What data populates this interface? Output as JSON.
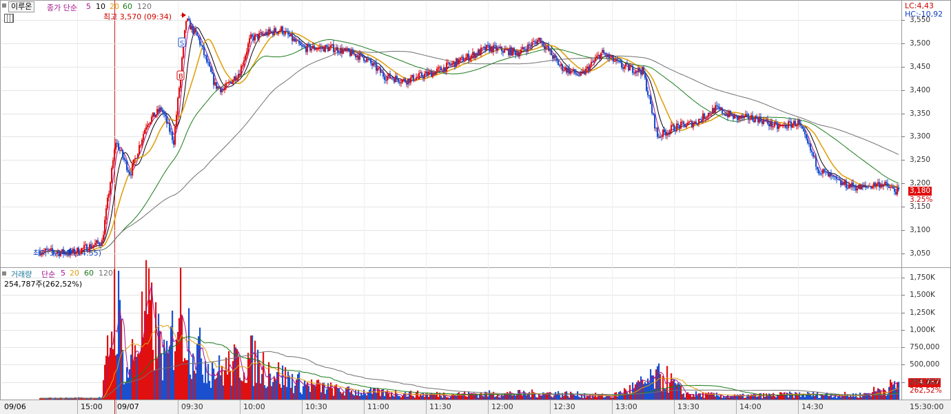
{
  "price_panel": {
    "stock_name": "이루온",
    "ma_label": "종가 단순",
    "periods": [
      "5",
      "10",
      "20",
      "60",
      "120"
    ],
    "period_colors": [
      "#a2148c",
      "#000000",
      "#e0a010",
      "#1a7a1a",
      "#707070"
    ],
    "high_label": "최고 3,570 (09:34)",
    "low_label": "최저 3,045 (14:55)",
    "lc": "LC:4,43",
    "hc": "HC:-10,92",
    "current_price": "3,180",
    "current_change": "3.25%",
    "signal_s": "S",
    "signal_b": "B"
  },
  "volume_panel": {
    "title": "거래량",
    "ma_label": "단순",
    "periods": [
      "5",
      "20",
      "60",
      "120"
    ],
    "value_text": "254,787주(262,52%)",
    "current_volume": "254,787",
    "current_ratio": "262,52%"
  },
  "chart_data": [
    {
      "type": "candlestick",
      "ylim": [
        3020,
        3590
      ],
      "yticks": [
        "3,050",
        "3,100",
        "3,150",
        "3,200",
        "3,250",
        "3,300",
        "3,350",
        "3,400",
        "3,450",
        "3,500",
        "3,550"
      ],
      "session_days": [
        "09/06",
        "09/07"
      ],
      "xticks": [
        "09/06",
        "15:00",
        "09/07",
        "09:30",
        "10:00",
        "10:30",
        "11:00",
        "11:30",
        "12:00",
        "12:30",
        "13:00",
        "13:30",
        "14:00",
        "14:30",
        "15:00",
        "15:30:00"
      ],
      "anchors": [
        {
          "t": "09/06 14:30",
          "v": 3055
        },
        {
          "t": "09/06 14:55",
          "v": 3050
        },
        {
          "t": "09/06 15:20",
          "v": 3075
        },
        {
          "t": "09:00",
          "v": 3290
        },
        {
          "t": "09:07",
          "v": 3220
        },
        {
          "t": "09:15",
          "v": 3330
        },
        {
          "t": "09:22",
          "v": 3360
        },
        {
          "t": "09:28",
          "v": 3290
        },
        {
          "t": "09:34",
          "v": 3550
        },
        {
          "t": "09:40",
          "v": 3510
        },
        {
          "t": "09:48",
          "v": 3410
        },
        {
          "t": "09:52",
          "v": 3400
        },
        {
          "t": "10:00",
          "v": 3440
        },
        {
          "t": "10:05",
          "v": 3510
        },
        {
          "t": "10:12",
          "v": 3520
        },
        {
          "t": "10:20",
          "v": 3530
        },
        {
          "t": "10:30",
          "v": 3490
        },
        {
          "t": "10:45",
          "v": 3490
        },
        {
          "t": "11:00",
          "v": 3470
        },
        {
          "t": "11:10",
          "v": 3430
        },
        {
          "t": "11:20",
          "v": 3420
        },
        {
          "t": "11:35",
          "v": 3440
        },
        {
          "t": "11:50",
          "v": 3470
        },
        {
          "t": "12:00",
          "v": 3490
        },
        {
          "t": "12:15",
          "v": 3480
        },
        {
          "t": "12:25",
          "v": 3510
        },
        {
          "t": "12:35",
          "v": 3450
        },
        {
          "t": "12:45",
          "v": 3430
        },
        {
          "t": "12:55",
          "v": 3480
        },
        {
          "t": "13:05",
          "v": 3450
        },
        {
          "t": "13:15",
          "v": 3440
        },
        {
          "t": "13:22",
          "v": 3300
        },
        {
          "t": "13:30",
          "v": 3320
        },
        {
          "t": "13:40",
          "v": 3330
        },
        {
          "t": "13:50",
          "v": 3360
        },
        {
          "t": "14:00",
          "v": 3340
        },
        {
          "t": "14:10",
          "v": 3340
        },
        {
          "t": "14:20",
          "v": 3320
        },
        {
          "t": "14:30",
          "v": 3330
        },
        {
          "t": "14:40",
          "v": 3230
        },
        {
          "t": "14:50",
          "v": 3200
        },
        {
          "t": "15:00",
          "v": 3190
        },
        {
          "t": "15:10",
          "v": 3200
        },
        {
          "t": "15:19",
          "v": 3180
        }
      ],
      "moving_averages": [
        {
          "period": 5,
          "color": "#a2148c"
        },
        {
          "period": 10,
          "color": "#000000"
        },
        {
          "period": 20,
          "color": "#e0a010"
        },
        {
          "period": 60,
          "color": "#1a7a1a"
        },
        {
          "period": 120,
          "color": "#707070"
        }
      ]
    },
    {
      "type": "bar",
      "ylim": [
        0,
        1900000
      ],
      "yticks": [
        "250,000",
        "500,000",
        "750,000",
        "1,000K",
        "1,250K",
        "1,500K",
        "1,750K"
      ],
      "volume_anchors": [
        {
          "t": "09/06 14:30",
          "v": 20000
        },
        {
          "t": "09/06 15:20",
          "v": 30000
        },
        {
          "t": "09:00",
          "v": 1900000
        },
        {
          "t": "09:05",
          "v": 420000
        },
        {
          "t": "09:15",
          "v": 1550000
        },
        {
          "t": "09:25",
          "v": 600000
        },
        {
          "t": "09:30",
          "v": 1720000
        },
        {
          "t": "09:40",
          "v": 800000
        },
        {
          "t": "09:50",
          "v": 500000
        },
        {
          "t": "10:05",
          "v": 720000
        },
        {
          "t": "10:20",
          "v": 420000
        },
        {
          "t": "10:30",
          "v": 280000
        },
        {
          "t": "10:50",
          "v": 150000
        },
        {
          "t": "11:30",
          "v": 90000
        },
        {
          "t": "12:30",
          "v": 110000
        },
        {
          "t": "13:00",
          "v": 60000
        },
        {
          "t": "13:25",
          "v": 420000
        },
        {
          "t": "13:35",
          "v": 100000
        },
        {
          "t": "14:00",
          "v": 60000
        },
        {
          "t": "14:30",
          "v": 90000
        },
        {
          "t": "15:00",
          "v": 80000
        },
        {
          "t": "15:18",
          "v": 254787
        }
      ]
    }
  ]
}
